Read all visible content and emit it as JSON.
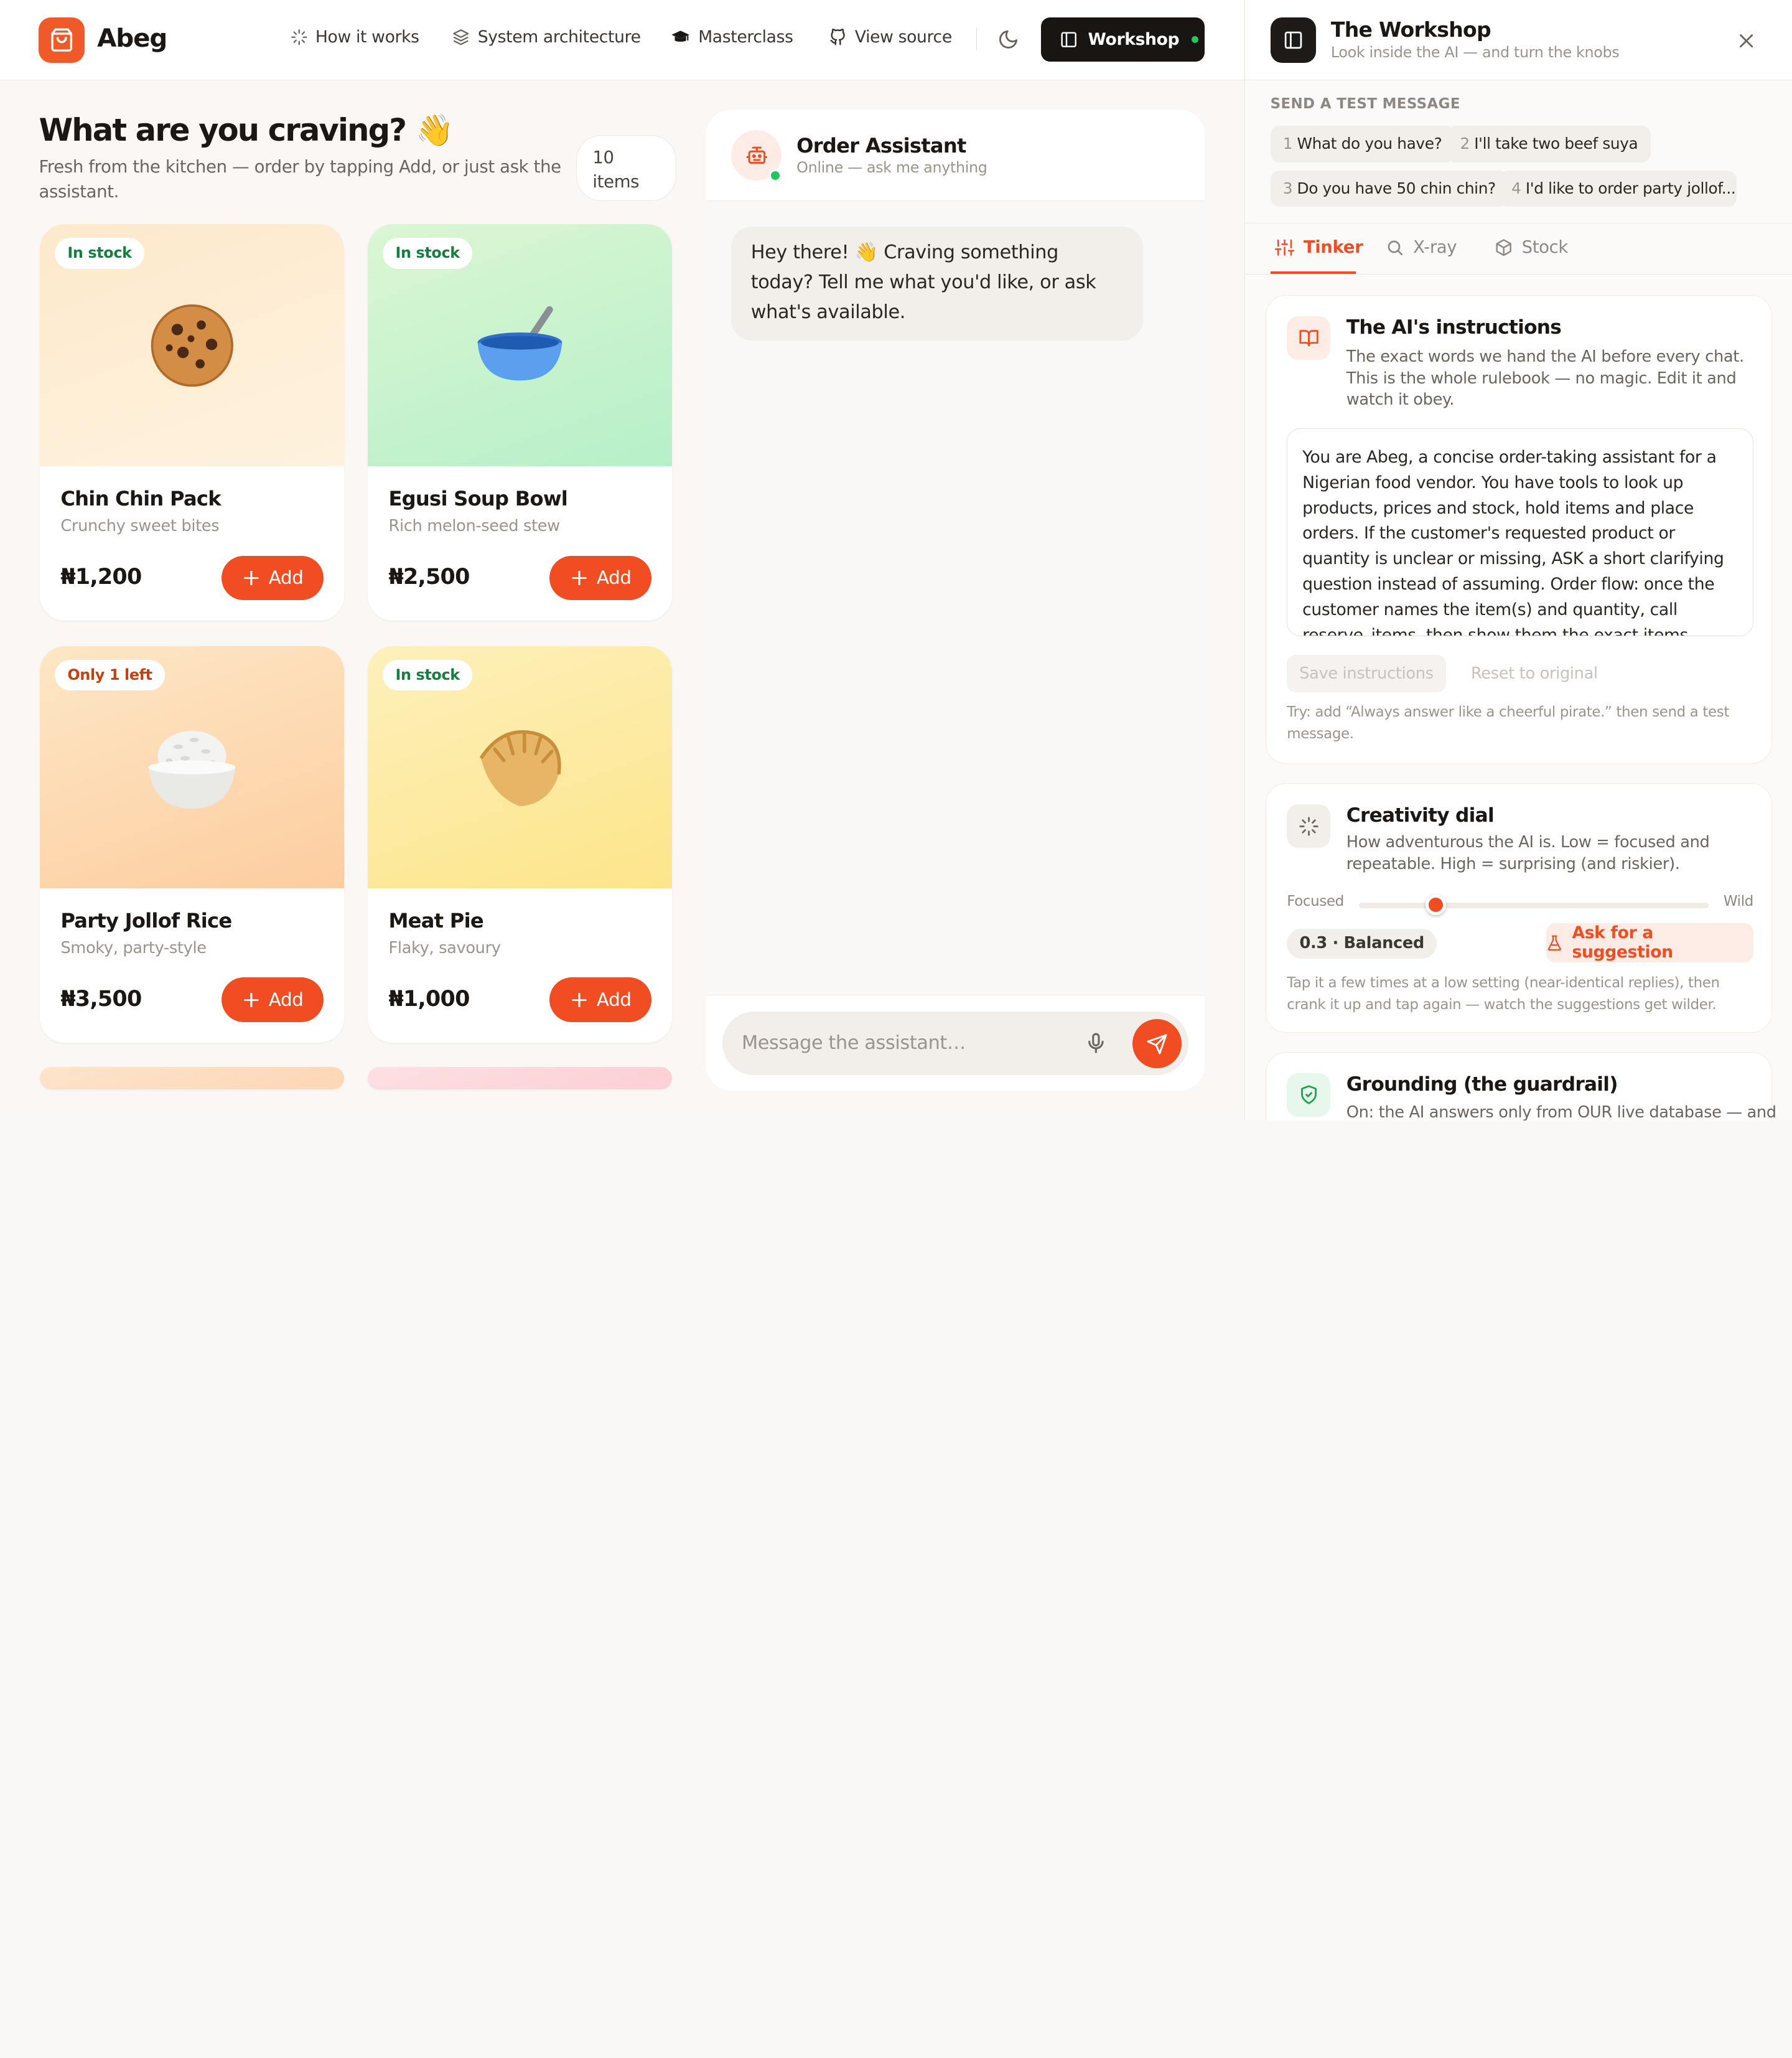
{
  "header": {
    "brand": "Abeg",
    "nav": [
      {
        "label": "How it works",
        "icon": "sparkle-icon"
      },
      {
        "label": "System architecture",
        "icon": "layers-icon"
      },
      {
        "label": "Masterclass",
        "icon": "graduation-cap-icon"
      },
      {
        "label": "View source",
        "icon": "github-icon"
      }
    ],
    "theme_icon": "moon-icon",
    "workshop_button": "Workshop"
  },
  "menu": {
    "heading": "What are you craving? 👋",
    "subtitle": "Fresh from the kitchen — order by tapping Add, or just ask the assistant.",
    "count_number": "10",
    "count_unit": "items",
    "add_label": "Add",
    "products": [
      {
        "badge": "In stock",
        "emoji": "🍪",
        "name": "Chin Chin Pack",
        "desc": "Crunchy sweet bites",
        "price": "₦1,200"
      },
      {
        "badge": "In stock",
        "emoji": "🥣",
        "name": "Egusi Soup Bowl",
        "desc": "Rich melon-seed stew",
        "price": "₦2,500"
      },
      {
        "badge": "Only 1 left",
        "emoji": "🍚",
        "name": "Party Jollof Rice",
        "desc": "Smoky, party-style",
        "price": "₦3,500"
      },
      {
        "badge": "In stock",
        "emoji": "🥟",
        "name": "Meat Pie",
        "desc": "Flaky, savoury",
        "price": "₦1,000"
      }
    ],
    "badge_colors": {
      "in_stock": "#15803d",
      "low_stock": "#c2410c"
    },
    "card_gradients": [
      [
        "#fde8c8",
        "#fef0d8"
      ],
      [
        "#d6f5d0",
        "#b8f0c8"
      ],
      [
        "#fde6c2",
        "#fdd0a2"
      ],
      [
        "#fdf0b8",
        "#fde68a"
      ]
    ]
  },
  "chat": {
    "title": "Order Assistant",
    "status": "Online — ask me anything",
    "greeting": "Hey there! 👋 Craving something today? Tell me what you'd like, or ask what's available.",
    "input_placeholder": "Message the assistant…"
  },
  "workshop": {
    "title": "The Workshop",
    "subtitle": "Look inside the AI — and turn the knobs",
    "send_label": "SEND A TEST MESSAGE",
    "chips": [
      {
        "n": "1",
        "text": "What do you have?"
      },
      {
        "n": "2",
        "text": "I'll take two beef suya"
      },
      {
        "n": "3",
        "text": "Do you have 50 chin chin?"
      },
      {
        "n": "4",
        "text": "I'd like to order party jollof..."
      }
    ],
    "tabs": [
      "Tinker",
      "X-ray",
      "Stock"
    ],
    "instructions": {
      "title": "The AI's instructions",
      "desc": "The exact words we hand the AI before every chat. This is the whole rulebook — no magic. Edit it and watch it obey.",
      "text": "You are Abeg, a concise order-taking assistant for a Nigerian food vendor. You have tools to look up products, prices and stock, hold items and place orders. If the customer's requested product or quantity is unclear or missing, ASK a short clarifying question instead of assuming. Order flow: once the customer names the item(s) and quantity, call reserve_items, then show them the exact items, quantities, unit prices and total and ask",
      "save": "Save instructions",
      "reset": "Reset to original",
      "hint": "Try: add “Always answer like a cheerful pirate.” then send a test message."
    },
    "creativity": {
      "title": "Creativity dial",
      "desc": "How adventurous the AI is. Low = focused and repeatable. High = surprising (and riskier).",
      "min_label": "Focused",
      "max_label": "Wild",
      "value": 0.3,
      "value_label": "0.3 · Balanced",
      "suggest": "Ask for a suggestion",
      "hint": "Tap it a few times at a low setting (near-identical replies), then crank it up and tap again — watch the suggestions get wilder."
    },
    "grounding": {
      "title": "Grounding (the guardrail)",
      "desc": "On: the AI answers only from OUR live database — and"
    }
  },
  "colors": {
    "accent": "#f04d23",
    "dark": "#181512",
    "success": "#22c55e"
  }
}
